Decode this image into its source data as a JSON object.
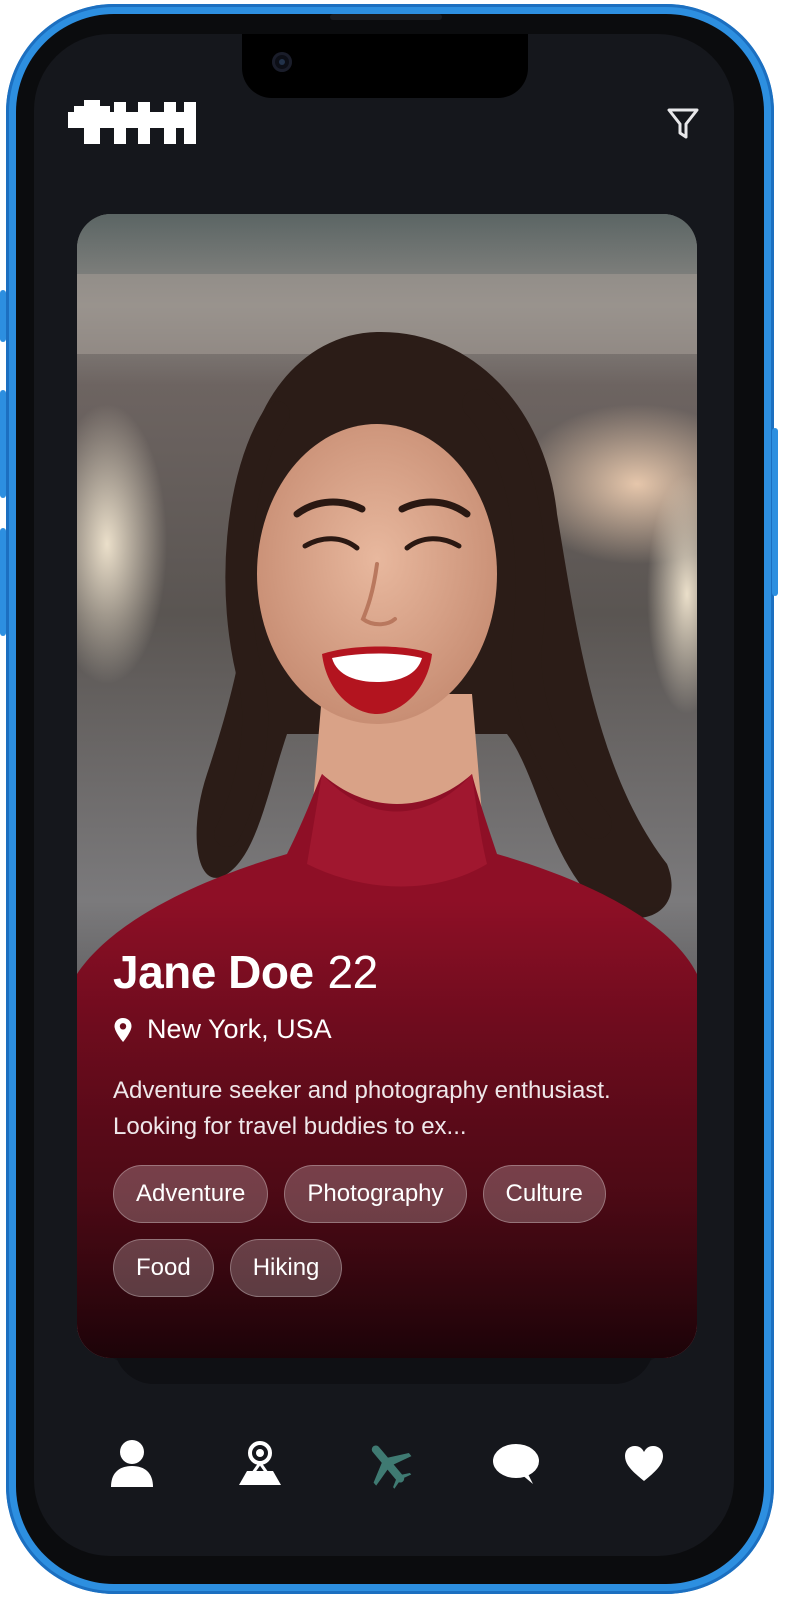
{
  "colors": {
    "frame": "#2d8fe0",
    "screen_bg": "#15171c",
    "nav_icon": "#ffffff",
    "nav_active": "#3f7a72",
    "tag_bg": "rgba(255,255,255,0.22)"
  },
  "header": {
    "logo_icon": "brand-logo",
    "filter_icon": "filter-funnel-icon"
  },
  "profile": {
    "name": "Jane Doe",
    "age": "22",
    "location": "New York, USA",
    "bio": "Adventure seeker and photography enthusiast. Looking for travel buddies to ex...",
    "tags": [
      "Adventure",
      "Photography",
      "Culture",
      "Food",
      "Hiking"
    ]
  },
  "bottom_nav": {
    "items": [
      {
        "icon": "profile-icon",
        "active": false
      },
      {
        "icon": "map-pin-person-icon",
        "active": false
      },
      {
        "icon": "airplane-icon",
        "active": true
      },
      {
        "icon": "chat-bubble-icon",
        "active": false
      },
      {
        "icon": "heart-icon",
        "active": false
      }
    ]
  }
}
